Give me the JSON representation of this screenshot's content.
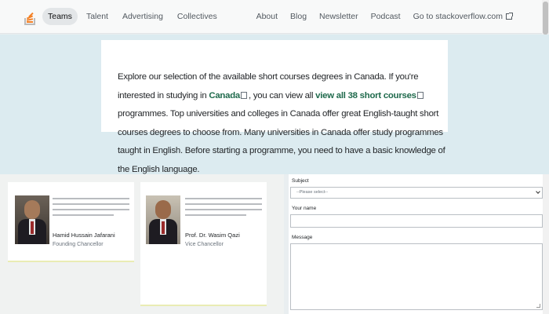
{
  "nav": {
    "left": [
      {
        "label": "Teams",
        "active": true
      },
      {
        "label": "Talent",
        "active": false
      },
      {
        "label": "Advertising",
        "active": false
      },
      {
        "label": "Collectives",
        "active": false
      }
    ],
    "right": [
      "About",
      "Blog",
      "Newsletter",
      "Podcast"
    ],
    "external_link": "Go to stackoverflow.com"
  },
  "blurb": {
    "part1": "Explore our selection of the available short courses degrees in Canada. If you're interested in studying in ",
    "link1": "Canada",
    "part2": ", you can view all ",
    "link2": "view all 38 short courses",
    "part3": " programmes. Top universities and colleges in Canada offer great English-taught short courses degrees to choose from. Many universities in Canada offer study programmes taught in English. Before starting a programme, you need to have a basic knowledge of the English language."
  },
  "profiles": [
    {
      "name": "Hamid Hussain Jafarani",
      "role": "Founding Chancellor"
    },
    {
      "name": "Prof. Dr. Wasim Qazi",
      "role": "Vice Chancellor"
    }
  ],
  "form": {
    "subject_label": "Subject",
    "subject_value": "--Please select--",
    "name_label": "Your name",
    "message_label": "Message"
  },
  "colors": {
    "accent": "#f48024",
    "link": "#1f6a4c",
    "band": "#dcebf0"
  }
}
